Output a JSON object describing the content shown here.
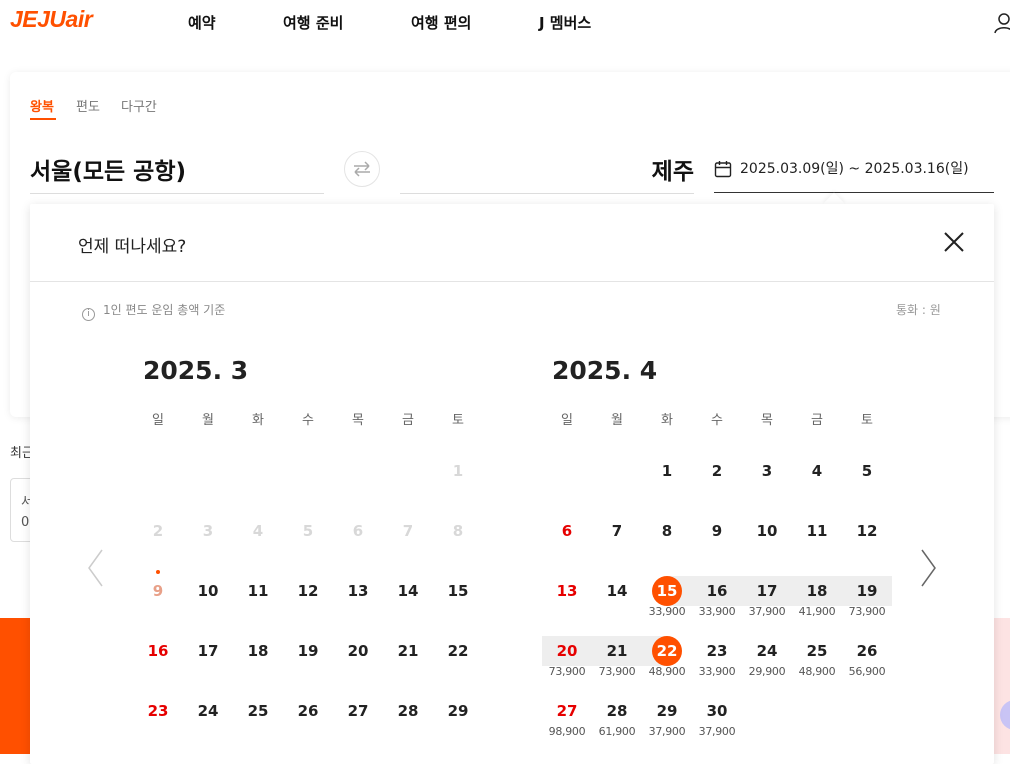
{
  "header": {
    "logo": {
      "brand": "JEJU",
      "suffix": "air"
    },
    "nav": [
      "예약",
      "여행 준비",
      "여행 편의",
      "J 멤버스"
    ]
  },
  "trip_tabs": [
    "왕복",
    "편도",
    "다구간"
  ],
  "route": {
    "origin": "서울(모든 공항)",
    "destination": "제주",
    "dates": "2025.03.09(일) ~ 2025.03.16(일)"
  },
  "recent": {
    "label": "최근",
    "card_line1": "서",
    "card_line2": "0"
  },
  "calendar": {
    "title": "언제 떠나세요?",
    "fare_note": "1인 편도 운임 총액 기준",
    "currency": "통화 : 원",
    "weekdays": [
      "일",
      "월",
      "화",
      "수",
      "목",
      "금",
      "토"
    ],
    "months": [
      {
        "label": "2025.  3",
        "first_weekday": 6,
        "rows_shown": 5,
        "days": [
          {
            "d": "1",
            "state": "disabled"
          },
          {
            "d": "2",
            "state": "disabled"
          },
          {
            "d": "3",
            "state": "disabled"
          },
          {
            "d": "4",
            "state": "disabled"
          },
          {
            "d": "5",
            "state": "disabled"
          },
          {
            "d": "6",
            "state": "disabled"
          },
          {
            "d": "7",
            "state": "disabled"
          },
          {
            "d": "8",
            "state": "disabled"
          },
          {
            "d": "9",
            "state": "past",
            "today": true
          },
          {
            "d": "10"
          },
          {
            "d": "11"
          },
          {
            "d": "12"
          },
          {
            "d": "13"
          },
          {
            "d": "14"
          },
          {
            "d": "15"
          },
          {
            "d": "16",
            "state": "red"
          },
          {
            "d": "17"
          },
          {
            "d": "18"
          },
          {
            "d": "19"
          },
          {
            "d": "20"
          },
          {
            "d": "21"
          },
          {
            "d": "22"
          },
          {
            "d": "23",
            "state": "red"
          },
          {
            "d": "24"
          },
          {
            "d": "25"
          },
          {
            "d": "26"
          },
          {
            "d": "27"
          },
          {
            "d": "28"
          },
          {
            "d": "29"
          }
        ]
      },
      {
        "label": "2025.  4",
        "first_weekday": 2,
        "rows_shown": 5,
        "days": [
          {
            "d": "1"
          },
          {
            "d": "2"
          },
          {
            "d": "3"
          },
          {
            "d": "4"
          },
          {
            "d": "5"
          },
          {
            "d": "6",
            "state": "red"
          },
          {
            "d": "7"
          },
          {
            "d": "8"
          },
          {
            "d": "9"
          },
          {
            "d": "10"
          },
          {
            "d": "11"
          },
          {
            "d": "12"
          },
          {
            "d": "13",
            "state": "red"
          },
          {
            "d": "14"
          },
          {
            "d": "15",
            "state": "selected",
            "price": "33,900"
          },
          {
            "d": "16",
            "price": "33,900"
          },
          {
            "d": "17",
            "price": "37,900"
          },
          {
            "d": "18",
            "price": "41,900"
          },
          {
            "d": "19",
            "price": "73,900"
          },
          {
            "d": "20",
            "state": "red",
            "price": "73,900"
          },
          {
            "d": "21",
            "price": "73,900"
          },
          {
            "d": "22",
            "state": "selected",
            "price": "48,900"
          },
          {
            "d": "23",
            "price": "33,900"
          },
          {
            "d": "24",
            "price": "29,900"
          },
          {
            "d": "25",
            "price": "48,900"
          },
          {
            "d": "26",
            "price": "56,900"
          },
          {
            "d": "27",
            "state": "red",
            "price": "98,900"
          },
          {
            "d": "28",
            "price": "61,900"
          },
          {
            "d": "29",
            "price": "37,900"
          },
          {
            "d": "30",
            "price": "37,900"
          }
        ]
      }
    ]
  },
  "colors": {
    "accent": "#ff5000",
    "sunday": "#e60000",
    "range_band": "#eeeeee",
    "disabled": "#d8d8d8"
  }
}
